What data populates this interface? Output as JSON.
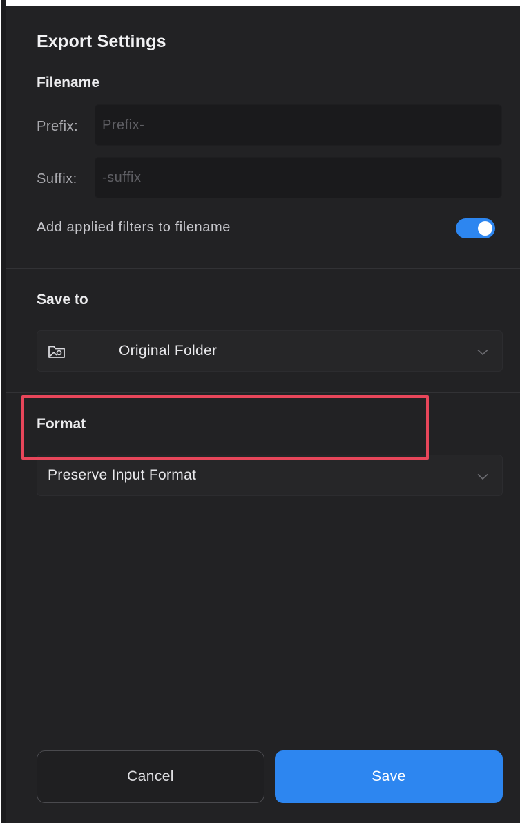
{
  "dialog": {
    "title": "Export Settings"
  },
  "filename": {
    "heading": "Filename",
    "prefix_label": "Prefix:",
    "prefix_placeholder": "Prefix-",
    "suffix_label": "Suffix:",
    "suffix_placeholder": "-suffix",
    "add_filters_label": "Add applied filters to filename",
    "add_filters_enabled": true
  },
  "save_to": {
    "heading": "Save to",
    "selected": "Original Folder",
    "icon": "folder-image-icon"
  },
  "format": {
    "heading": "Format",
    "selected": "Preserve Input Format"
  },
  "actions": {
    "cancel_label": "Cancel",
    "save_label": "Save"
  },
  "colors": {
    "panel_bg": "#222224",
    "accent": "#2d86f0",
    "highlight": "#e8465a"
  }
}
